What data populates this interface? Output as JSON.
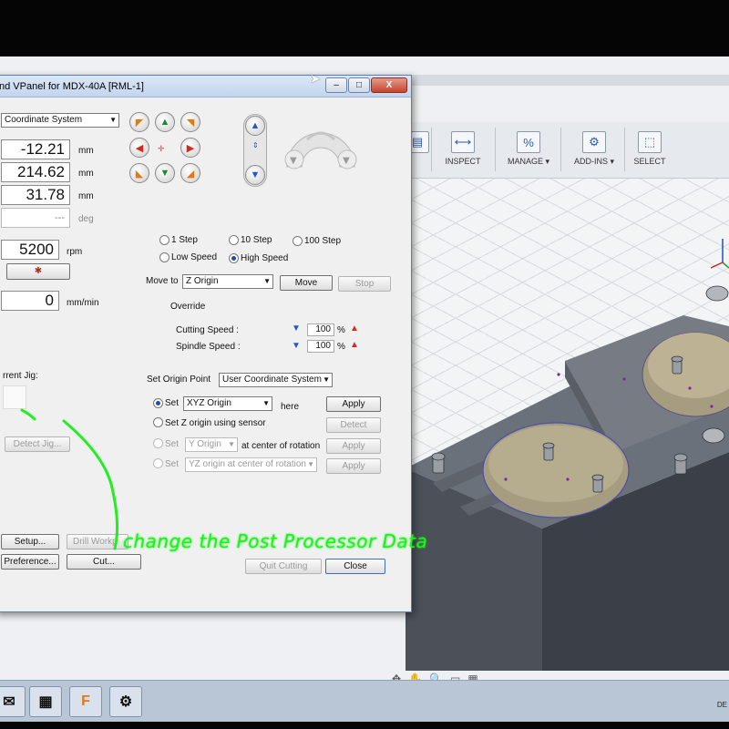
{
  "window": {
    "title": "nd VPanel for MDX-40A [RML-1]",
    "minimize": "–",
    "maximize": "□",
    "close": "X"
  },
  "coords": {
    "system": "Coordinate System",
    "x": "-12.21",
    "y": "214.62",
    "z": "31.78",
    "a": "---",
    "unit_mm": "mm",
    "unit_deg": "deg"
  },
  "spindle": {
    "rpm": "5200",
    "rpm_unit": "rpm",
    "feed": "0",
    "feed_unit": "mm/min"
  },
  "step": {
    "one": "1 Step",
    "ten": "10 Step",
    "hundred": "100 Step",
    "low": "Low Speed",
    "high": "High Speed",
    "selected": "High Speed"
  },
  "move": {
    "label": "Move to",
    "target": "Z Origin",
    "move_btn": "Move",
    "stop_btn": "Stop"
  },
  "override": {
    "label": "Override",
    "cutting_label": "Cutting Speed :",
    "cutting_value": "100",
    "spindle_label": "Spindle Speed :",
    "spindle_value": "100",
    "unit": "%"
  },
  "origin": {
    "label": "Set Origin Point",
    "system": "User Coordinate System",
    "set_label": "Set",
    "xyz_option": "XYZ Origin",
    "here": "here",
    "apply": "Apply",
    "set_z_sensor": "Set Z origin using sensor",
    "detect": "Detect",
    "y_origin": "Y Origin",
    "center_rotation": "at center of rotation",
    "yz_origin": "YZ origin at center of rotation"
  },
  "jig": {
    "label": "rrent Jig:",
    "detect_btn": "Detect Jig..."
  },
  "bottom": {
    "setup": "Setup...",
    "drill": "Drill Workp",
    "preference": "Preference...",
    "cut": "Cut...",
    "quit": "Quit Cutting",
    "close": "Close"
  },
  "annotation": "change the Post Processor Data",
  "cad": {
    "toolbar": [
      {
        "label": "INSPECT",
        "icon": "ruler-icon"
      },
      {
        "label": "MANAGE ▾",
        "icon": "manage-icon"
      },
      {
        "label": "ADD-INS ▾",
        "icon": "addins-icon"
      },
      {
        "label": "SELECT",
        "icon": "cursor-icon"
      }
    ],
    "taskbar_clock": "DE"
  },
  "colors": {
    "annotation": "#22ee22",
    "dialog_bg": "#f0f0f0",
    "part": "#4a4f58",
    "part_top": "#6a7079",
    "pocket": "#a39a7e"
  }
}
